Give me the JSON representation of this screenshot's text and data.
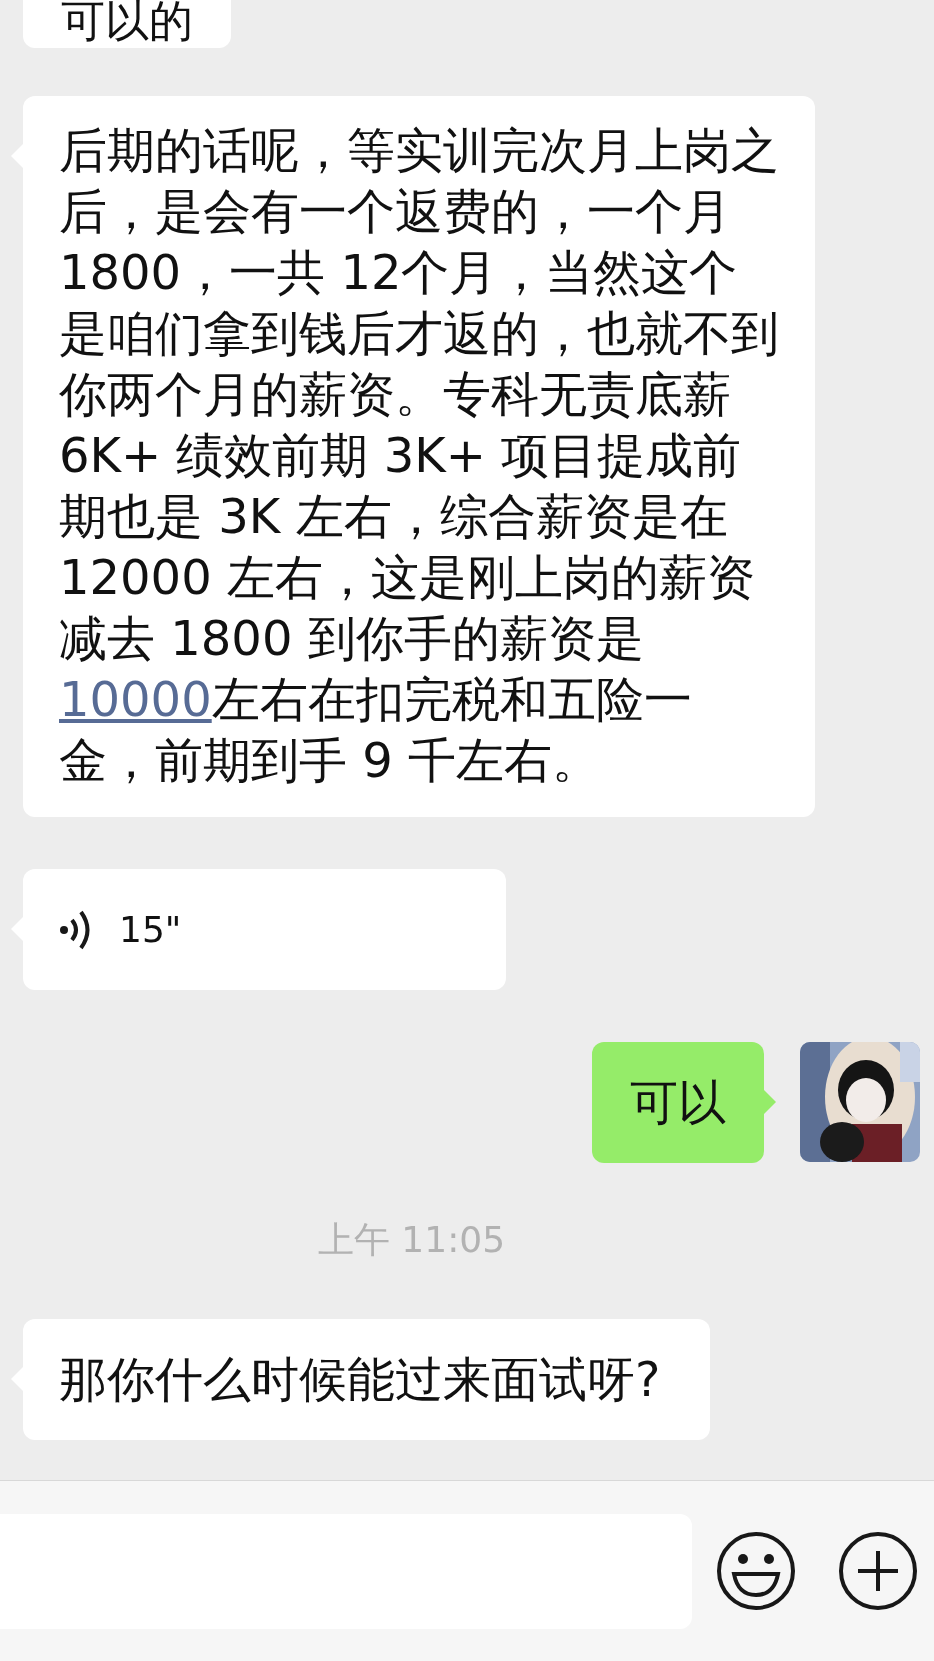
{
  "messages": [
    {
      "kind": "text",
      "sent": false,
      "text": "可以的"
    },
    {
      "kind": "rich",
      "sent": false,
      "segments": [
        {
          "kind": "plain",
          "text": "后期的话呢，等实训完次月上岗之后，是会有一个返费的，一个月1800，一共 12个月，当然这个是咱们拿到钱后才返的，也就不到你两个月的薪资。专科无责底薪 6K+ 绩效前期 3K+ 项目提成前期也是 3K 左右，综合薪资是在 12000 左右，这是刚上岗的薪资减去 1800 到你手的薪资是"
        },
        {
          "kind": "link",
          "text": "10000"
        },
        {
          "kind": "plain",
          "text": "左右在扣完税和五险一金，前期到手 9 千左右。"
        }
      ]
    },
    {
      "kind": "voice",
      "sent": false,
      "text": "15\""
    },
    {
      "kind": "text",
      "sent": true,
      "text": "可以"
    },
    {
      "kind": "time",
      "text": "上午 11:05"
    },
    {
      "kind": "text",
      "sent": false,
      "text": "那你什么时候能过来面试呀?"
    }
  ]
}
